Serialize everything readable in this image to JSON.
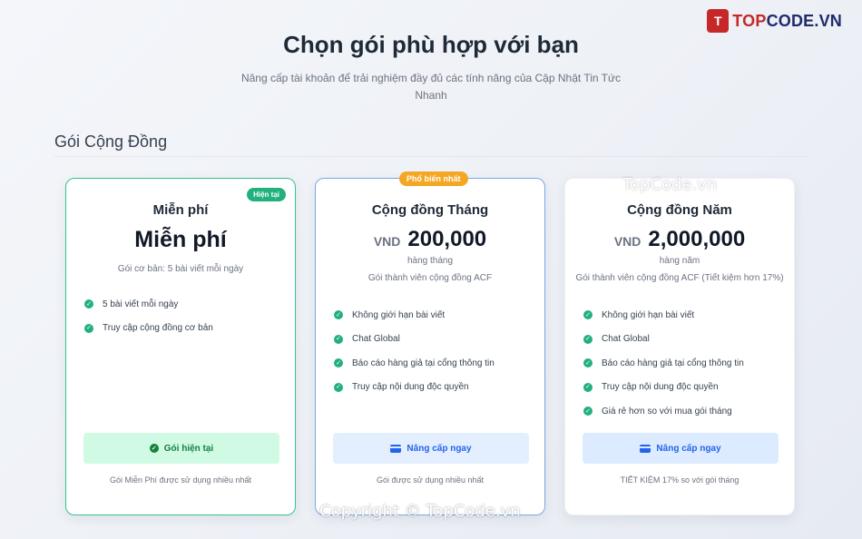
{
  "brand": {
    "mark": "T",
    "text_red": "TOP",
    "text_blue": "CODE.VN"
  },
  "hero": {
    "title": "Chọn gói phù hợp với bạn",
    "subtitle": "Nâng cấp tài khoản để trải nghiệm đầy đủ các tính năng của Cập Nhật Tin Tức Nhanh"
  },
  "section": {
    "title": "Gói Cộng Đồng"
  },
  "plans": [
    {
      "name": "Miễn phí",
      "price": "Miễn phí",
      "badge": "Hiện tại",
      "desc": "Gói cơ bản: 5 bài viết mỗi ngày",
      "features": [
        "5 bài viết mỗi ngày",
        "Truy cập cộng đồng cơ bản"
      ],
      "cta": "Gói hiện tại",
      "note": "Gói Miễn Phí được sử dụng nhiều nhất"
    },
    {
      "name": "Cộng đồng Tháng",
      "currency": "VND",
      "price": "200,000",
      "period": "hàng tháng",
      "badge": "Phổ biến nhất",
      "desc": "Gói thành viên cộng đồng ACF",
      "features": [
        "Không giới hạn bài viết",
        "Chat Global",
        "Báo cáo hàng giả tại cổng thông tin",
        "Truy cập nội dung độc quyền"
      ],
      "cta": "Nâng cấp ngay",
      "note": "Gói được sử dụng nhiều nhất"
    },
    {
      "name": "Cộng đồng Năm",
      "currency": "VND",
      "price": "2,000,000",
      "period": "hàng năm",
      "desc": "Gói thành viên cộng đồng ACF (Tiết kiệm hơn 17%)",
      "features": [
        "Không giới hạn bài viết",
        "Chat Global",
        "Báo cáo hàng giả tại cổng thông tin",
        "Truy cập nội dung độc quyền",
        "Giá rẻ hơn so với mua gói tháng"
      ],
      "cta": "Nâng cấp ngay",
      "note": "TIẾT KIỆM 17% so với gói tháng"
    }
  ],
  "watermarks": {
    "top": "TopCode.vn",
    "bottom": "Copyright © TopCode.vn"
  },
  "colors": {
    "accent_green": "#22b07d",
    "accent_blue": "#2563eb",
    "badge_orange": "#f5a623",
    "brand_red": "#c62828"
  }
}
